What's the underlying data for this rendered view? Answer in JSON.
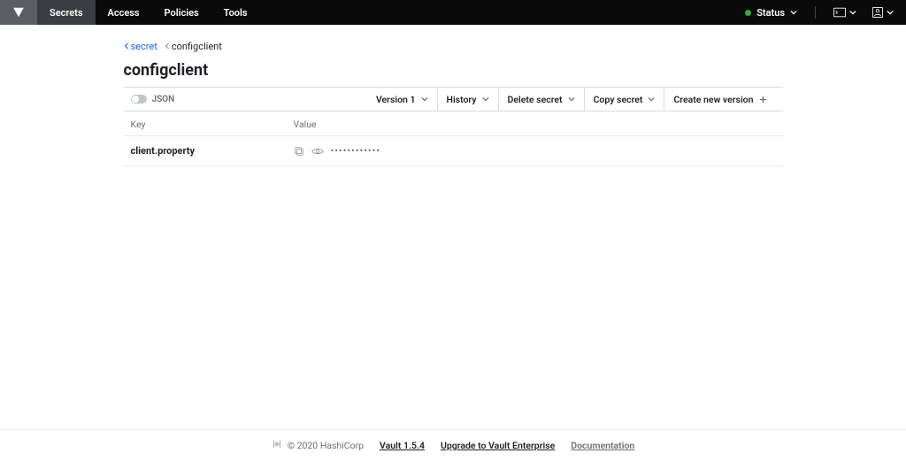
{
  "nav": {
    "items": [
      "Secrets",
      "Access",
      "Policies",
      "Tools"
    ],
    "status_label": "Status"
  },
  "breadcrumb": {
    "parent": "secret",
    "current": "configclient"
  },
  "page": {
    "title": "configclient"
  },
  "toolbar": {
    "json_label": "JSON",
    "version_label": "Version 1",
    "history_label": "History",
    "delete_label": "Delete secret",
    "copy_label": "Copy secret",
    "create_label": "Create new version"
  },
  "table": {
    "header_key": "Key",
    "header_value": "Value",
    "rows": [
      {
        "key": "client.property",
        "masked": "••••••••••••"
      }
    ]
  },
  "footer": {
    "copyright": "© 2020 HashiCorp",
    "version": "Vault 1.5.4",
    "upgrade": "Upgrade to Vault Enterprise",
    "docs": "Documentation"
  }
}
